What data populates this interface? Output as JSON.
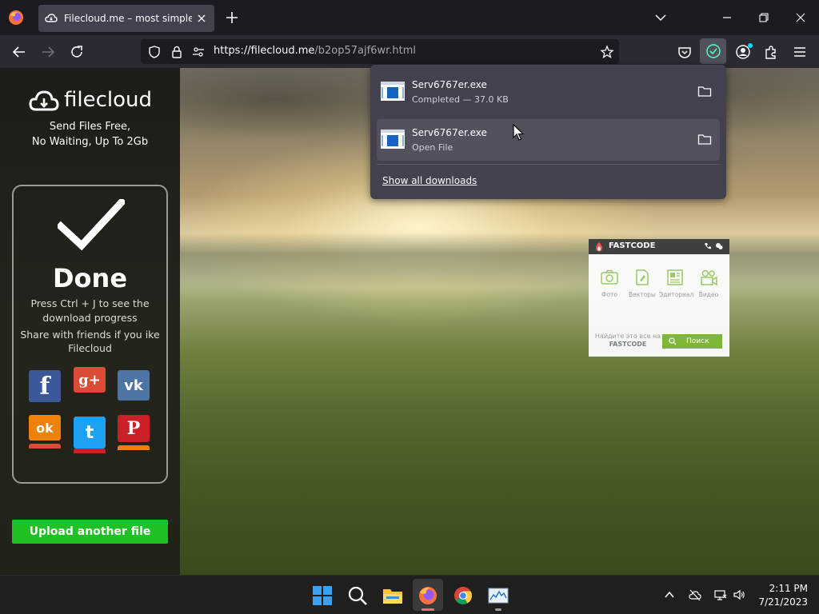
{
  "browser": {
    "tab": {
      "title": "Filecloud.me – most simple file sharing"
    },
    "url": {
      "host": "https://filecloud.me",
      "path": "/b2op57ajf6wr.html"
    }
  },
  "downloads": {
    "items": [
      {
        "name": "Serv6767er.exe",
        "status": "Completed — 37.0 KB"
      },
      {
        "name": "Serv6767er.exe",
        "status": "Open File"
      }
    ],
    "show_all": "Show all downloads"
  },
  "page": {
    "brand": "filecloud",
    "tagline": [
      "Send Files Free,",
      "No Waiting, Up To 2Gb"
    ],
    "done_title": "Done",
    "done_lines": [
      "Press Ctrl + J to see the",
      "download progress",
      "Share with friends if you ike",
      "Filecloud"
    ],
    "social": [
      {
        "name": "facebook",
        "glyph": "f",
        "color": "#3b5998"
      },
      {
        "name": "google-plus",
        "glyph": "g+",
        "color": "#dc4a38"
      },
      {
        "name": "vk",
        "glyph": "vk",
        "color": "#4c75a3"
      },
      {
        "name": "odnoklassniki",
        "glyph": "ok",
        "color": "#ee8208"
      },
      {
        "name": "twitter",
        "glyph": "t",
        "color": "#1da1f2"
      },
      {
        "name": "pinterest",
        "glyph": "P",
        "color": "#cb2027"
      }
    ],
    "upload_button": "Upload another file"
  },
  "fastcode": {
    "title": "FASTCODE",
    "items": [
      "Фото",
      "Векторы",
      "Эдиториал",
      "Видео"
    ],
    "find_text": "Найдите это все на",
    "find_brand": "FASTCODE",
    "search": "Поиск"
  },
  "taskbar": {
    "time": "2:11 PM",
    "date": "7/21/2023"
  },
  "colors": {
    "accent_green": "#1fc224",
    "panel": "#42414d",
    "toolbar": "#2b2a33"
  }
}
